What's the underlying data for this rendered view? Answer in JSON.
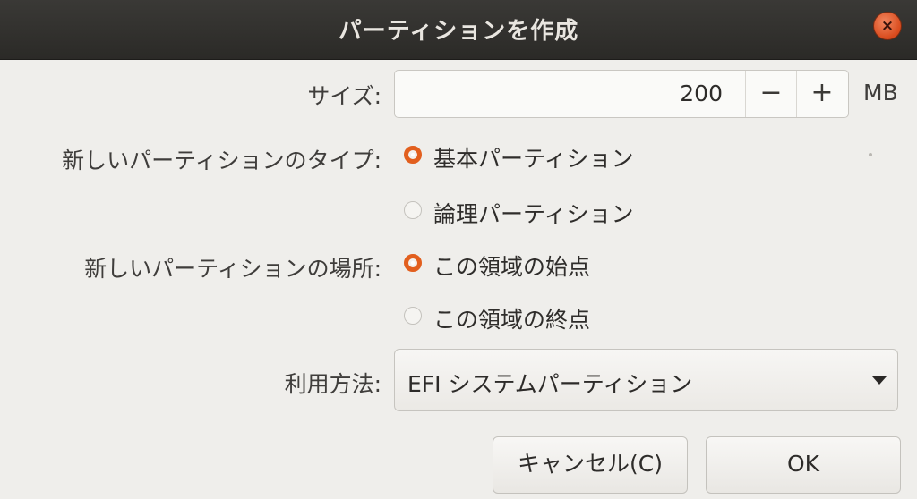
{
  "dialog": {
    "title": "パーティションを作成",
    "close_label": "×"
  },
  "size": {
    "label": "サイズ:",
    "value": "200",
    "decrement_label": "−",
    "increment_label": "+",
    "unit": "MB"
  },
  "partition_type": {
    "label": "新しいパーティションのタイプ:",
    "options": [
      {
        "label": "基本パーティション",
        "selected": true
      },
      {
        "label": "論理パーティション",
        "selected": false
      }
    ]
  },
  "partition_location": {
    "label": "新しいパーティションの場所:",
    "options": [
      {
        "label": "この領域の始点",
        "selected": true
      },
      {
        "label": "この領域の終点",
        "selected": false
      }
    ]
  },
  "use_as": {
    "label": "利用方法:",
    "selected": "EFI システムパーティション"
  },
  "buttons": {
    "cancel": "キャンセル(C)",
    "ok": "OK"
  },
  "colors": {
    "accent": "#e25f1e",
    "titlebar": "#2b2a27",
    "background": "#efeeeb"
  }
}
